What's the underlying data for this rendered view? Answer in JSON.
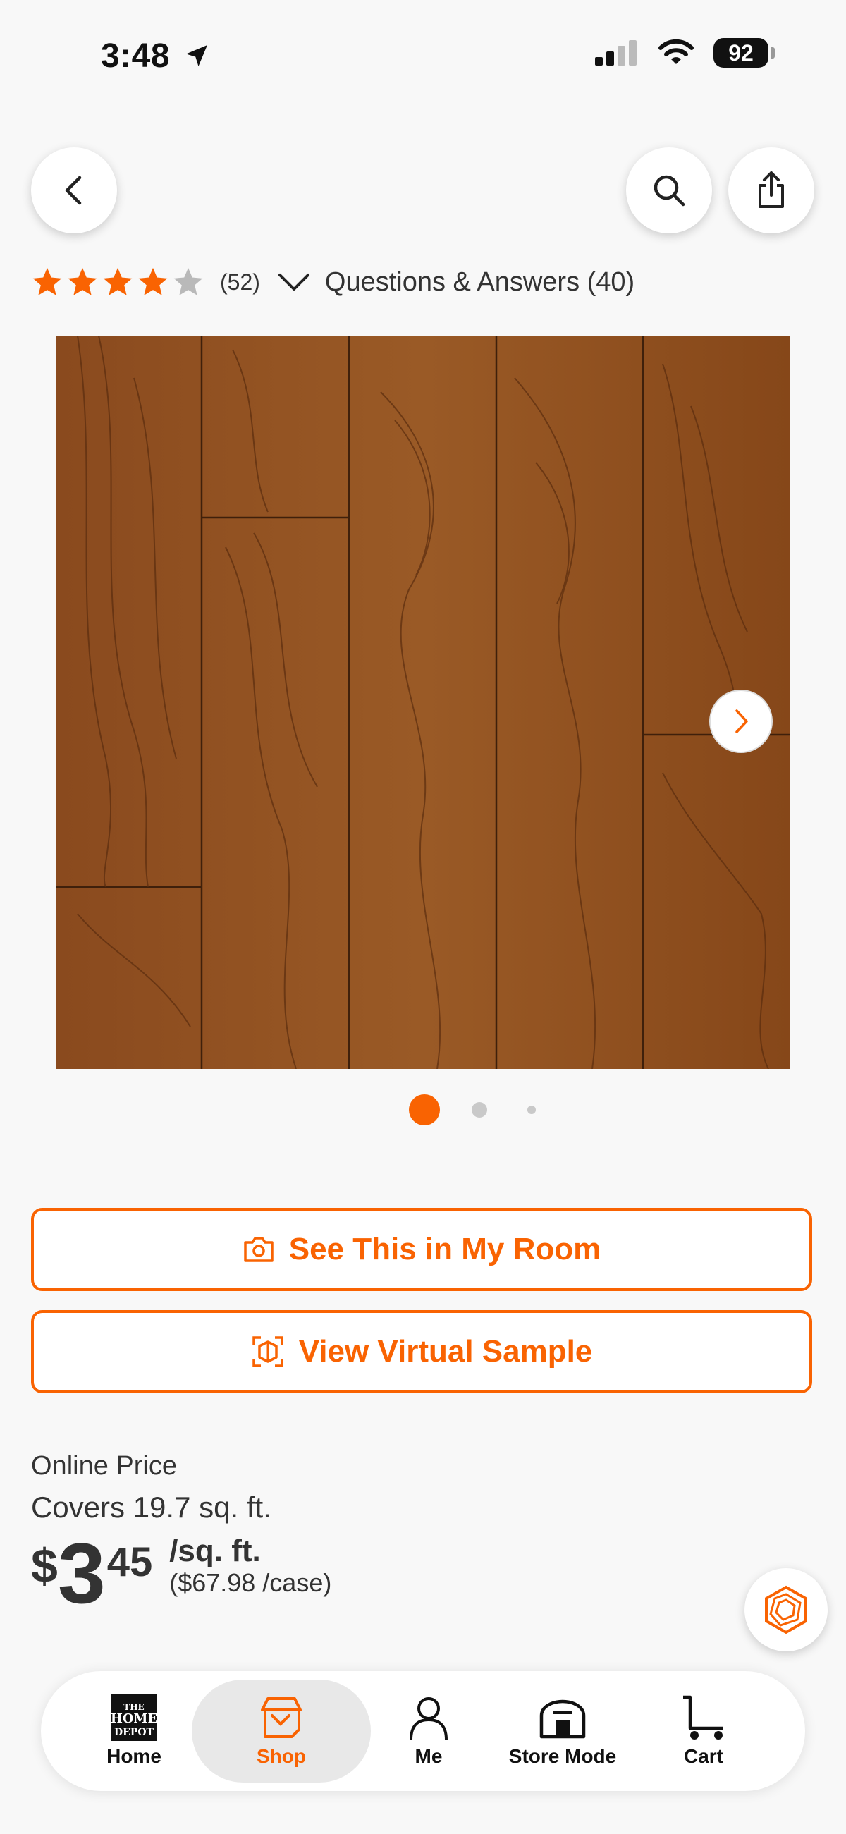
{
  "status_bar": {
    "time": "3:48",
    "battery": "92"
  },
  "rating": {
    "stars_filled": 4,
    "stars_total": 5,
    "count": "(52)",
    "qa_label": "Questions & Answers (40)"
  },
  "carousel": {
    "active_index": 0,
    "total": 3
  },
  "buttons": {
    "see_in_room": "See This in My Room",
    "virtual_sample": "View Virtual Sample"
  },
  "price": {
    "label": "Online Price",
    "coverage": "Covers 19.7 sq. ft.",
    "dollar_sign": "$",
    "dollars": "3",
    "cents": "45",
    "unit": "/sq. ft.",
    "per_case": "($67.98 /case)"
  },
  "nav": {
    "items": [
      {
        "label": "Home",
        "icon": "home-depot-logo-icon"
      },
      {
        "label": "Shop",
        "icon": "shop-icon",
        "active": true
      },
      {
        "label": "Me",
        "icon": "person-icon"
      },
      {
        "label": "Store Mode",
        "icon": "store-icon"
      },
      {
        "label": "Cart",
        "icon": "cart-icon"
      }
    ]
  },
  "colors": {
    "accent": "#f96302",
    "text": "#333333",
    "star_empty": "#b9b9b9"
  }
}
